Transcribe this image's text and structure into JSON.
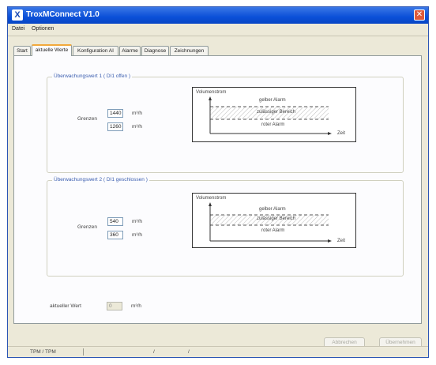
{
  "window": {
    "title": "TroxMConnect V1.0",
    "close_glyph": "✕",
    "logo_glyph": "X"
  },
  "menu": {
    "items": [
      "Datei",
      "Optionen"
    ]
  },
  "tabs": [
    "Start",
    "aktuelle Werte",
    "Konfiguration AI",
    "Alarme",
    "Diagnose",
    "Zeichnungen"
  ],
  "active_tab": "aktuelle Werte",
  "group1": {
    "title": "Überwachungswert 1 ( DI1 offen )",
    "limits_label": "Grenzen",
    "upper_value": "1440",
    "lower_value": "1260",
    "unit": "m³/h"
  },
  "group2": {
    "title": "Überwachungswert 2 ( DI1 geschlossen )",
    "limits_label": "Grenzen",
    "upper_value": "540",
    "lower_value": "360",
    "unit": "m³/h"
  },
  "diagram": {
    "y_axis": "Volumenstrom",
    "x_axis": "Zeit",
    "upper_zone": "gelber Alarm",
    "middle_zone": "zulässiger Bereich",
    "lower_zone": "roter Alarm"
  },
  "current": {
    "label": "aktueller Wert",
    "value": "0",
    "unit": "m³/h"
  },
  "buttons": {
    "cancel": "Abbrechen",
    "apply": "Übernehmen"
  },
  "status": {
    "left": "TPM / TPM",
    "sep1": "/",
    "sep2": "/"
  },
  "colors": {
    "titlebar": "#0a4fd8",
    "accent_text": "#3c5fb0",
    "tab_highlight": "#f2a93b"
  }
}
